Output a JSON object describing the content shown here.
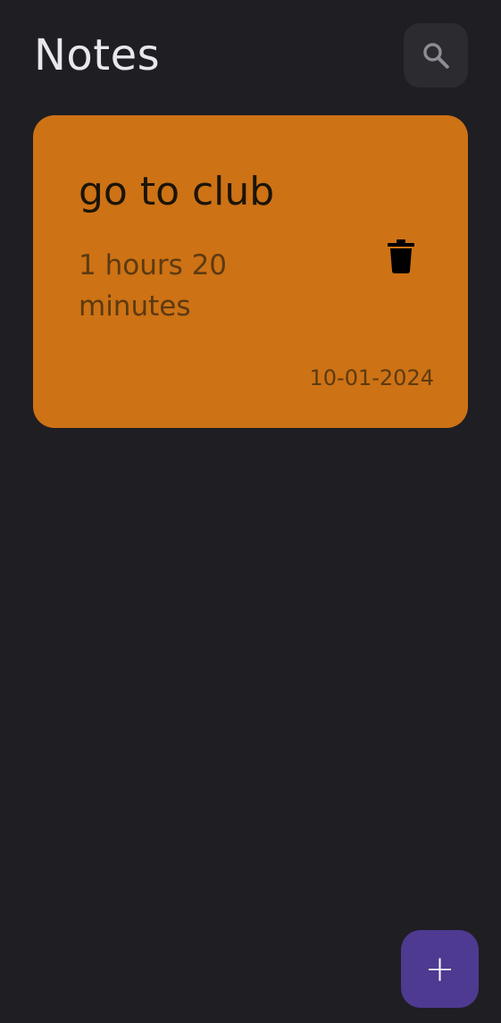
{
  "header": {
    "title": "Notes",
    "search_icon": "search-icon"
  },
  "notes": [
    {
      "title": "go to club",
      "duration": "1 hours 20 minutes",
      "date": "10-01-2024",
      "color": "#cd7215",
      "delete_icon": "trash-icon"
    }
  ],
  "fab": {
    "label": "+",
    "icon": "plus-icon",
    "color": "#4e3a90"
  },
  "theme": {
    "background": "#1f1e23",
    "search_button_bg": "#2c2b30"
  }
}
